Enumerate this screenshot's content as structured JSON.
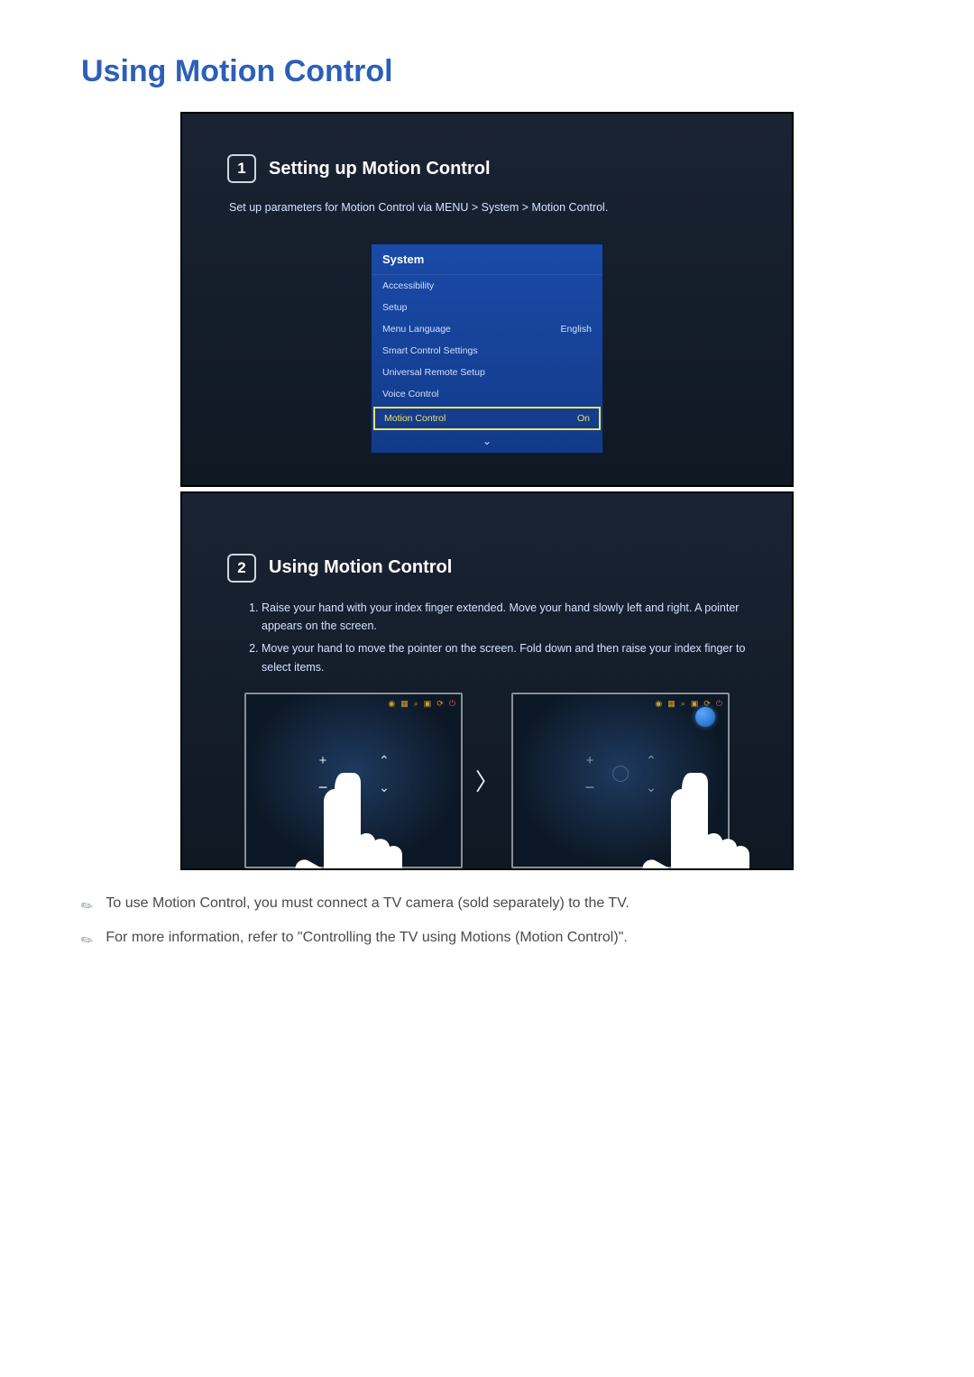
{
  "page": {
    "title": "Using Motion Control"
  },
  "panel1": {
    "step_number": "1",
    "step_title": "Setting up Motion Control",
    "description": "Set up parameters for Motion Control via MENU > System > Motion Control.",
    "menu": {
      "title": "System",
      "items": [
        {
          "label": "Accessibility",
          "value": ""
        },
        {
          "label": "Setup",
          "value": ""
        },
        {
          "label": "Menu Language",
          "value": "English"
        },
        {
          "label": "Smart Control Settings",
          "value": ""
        },
        {
          "label": "Universal Remote Setup",
          "value": ""
        },
        {
          "label": "Voice Control",
          "value": ""
        }
      ],
      "highlight": {
        "label": "Motion Control",
        "value": "On"
      }
    }
  },
  "panel2": {
    "step_number": "2",
    "step_title": "Using Motion Control",
    "steps": [
      "Raise your hand with your index finger extended. Move your hand slowly left and right. A pointer appears on the screen.",
      "Move your hand to move the pointer on the screen. Fold down and then raise your index finger to select items."
    ]
  },
  "notes": [
    "To use Motion Control, you must connect a TV camera (sold separately) to the TV.",
    "For more information, refer to \"Controlling the TV using Motions (Motion Control)\"."
  ]
}
